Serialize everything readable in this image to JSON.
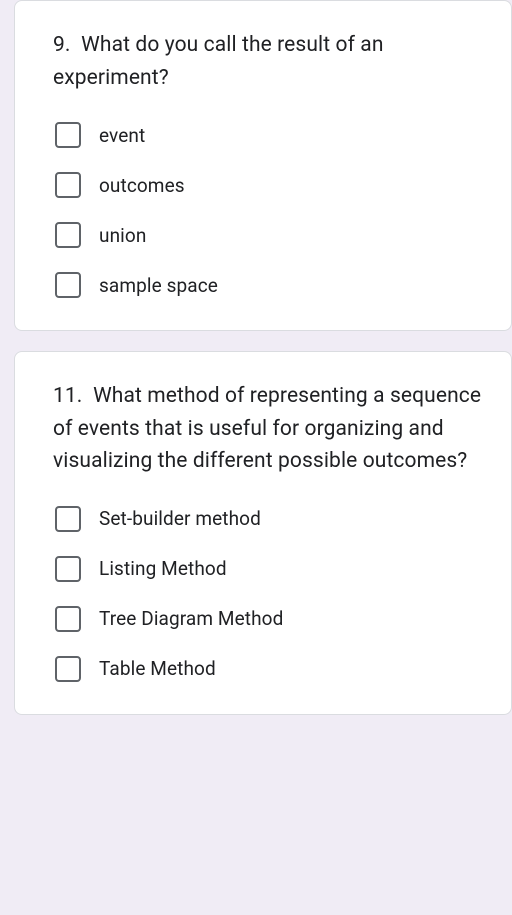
{
  "questions": [
    {
      "number": "9.",
      "text": "What do you call the result of an experiment?",
      "options": [
        "event",
        "outcomes",
        "union",
        "sample space"
      ]
    },
    {
      "number": "11.",
      "text": "What method of representing a sequence of events that is useful for organizing and visualizing the different possible outcomes?",
      "options": [
        "Set-builder method",
        "Listing Method",
        "Tree Diagram Method",
        "Table Method"
      ]
    }
  ]
}
